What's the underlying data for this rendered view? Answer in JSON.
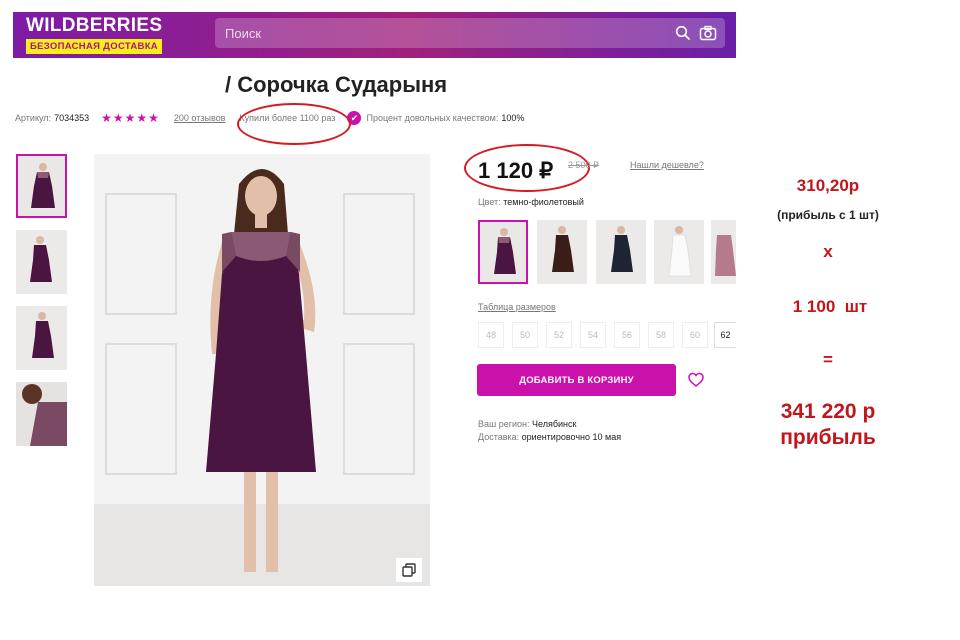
{
  "header": {
    "logo": "WILDBERRIES",
    "tagline": "БЕЗОПАСНАЯ ДОСТАВКА",
    "search_placeholder": "Поиск",
    "search_icon": "search-icon",
    "camera_icon": "camera-icon"
  },
  "product": {
    "title": "/ Сорочка Сударыня",
    "article_label": "Артикул:",
    "article": "7034353",
    "stars": "★★★★★",
    "rating": 5,
    "reviews": "200 отзывов",
    "bought": "Купили более 1100 раз",
    "quality_label": "Процент довольных качеством:",
    "quality_value": "100%"
  },
  "pricing": {
    "price": "1 120 ₽",
    "old_price": "2 500 ₽",
    "cheaper": "Нашли дешевле?"
  },
  "color": {
    "label": "Цвет:",
    "value": "темно-фиолетовый"
  },
  "sizes": {
    "table_link": "Таблица размеров",
    "list": [
      "48",
      "50",
      "52",
      "54",
      "56",
      "58",
      "60",
      "62"
    ]
  },
  "cart": {
    "button": "ДОБАВИТЬ В КОРЗИНУ",
    "heart_icon": "heart-icon"
  },
  "delivery": {
    "region_label": "Ваш регион:",
    "region": "Челябинск",
    "delivery_label": "Доставка:",
    "delivery_value": "ориентировочно 10 мая"
  },
  "calculation": {
    "profit_per_unit": "310,20р",
    "profit_per_unit_note": "(прибыль с 1 шт)",
    "times": "х",
    "quantity": "1 100  шт",
    "equals": "=",
    "total": "341 220 р",
    "total_label": "прибыль"
  },
  "colors": {
    "brand": "#cb11ab",
    "header_start": "#7d1ca5",
    "dress": "#4a1540",
    "annotation": "#c0161c"
  }
}
